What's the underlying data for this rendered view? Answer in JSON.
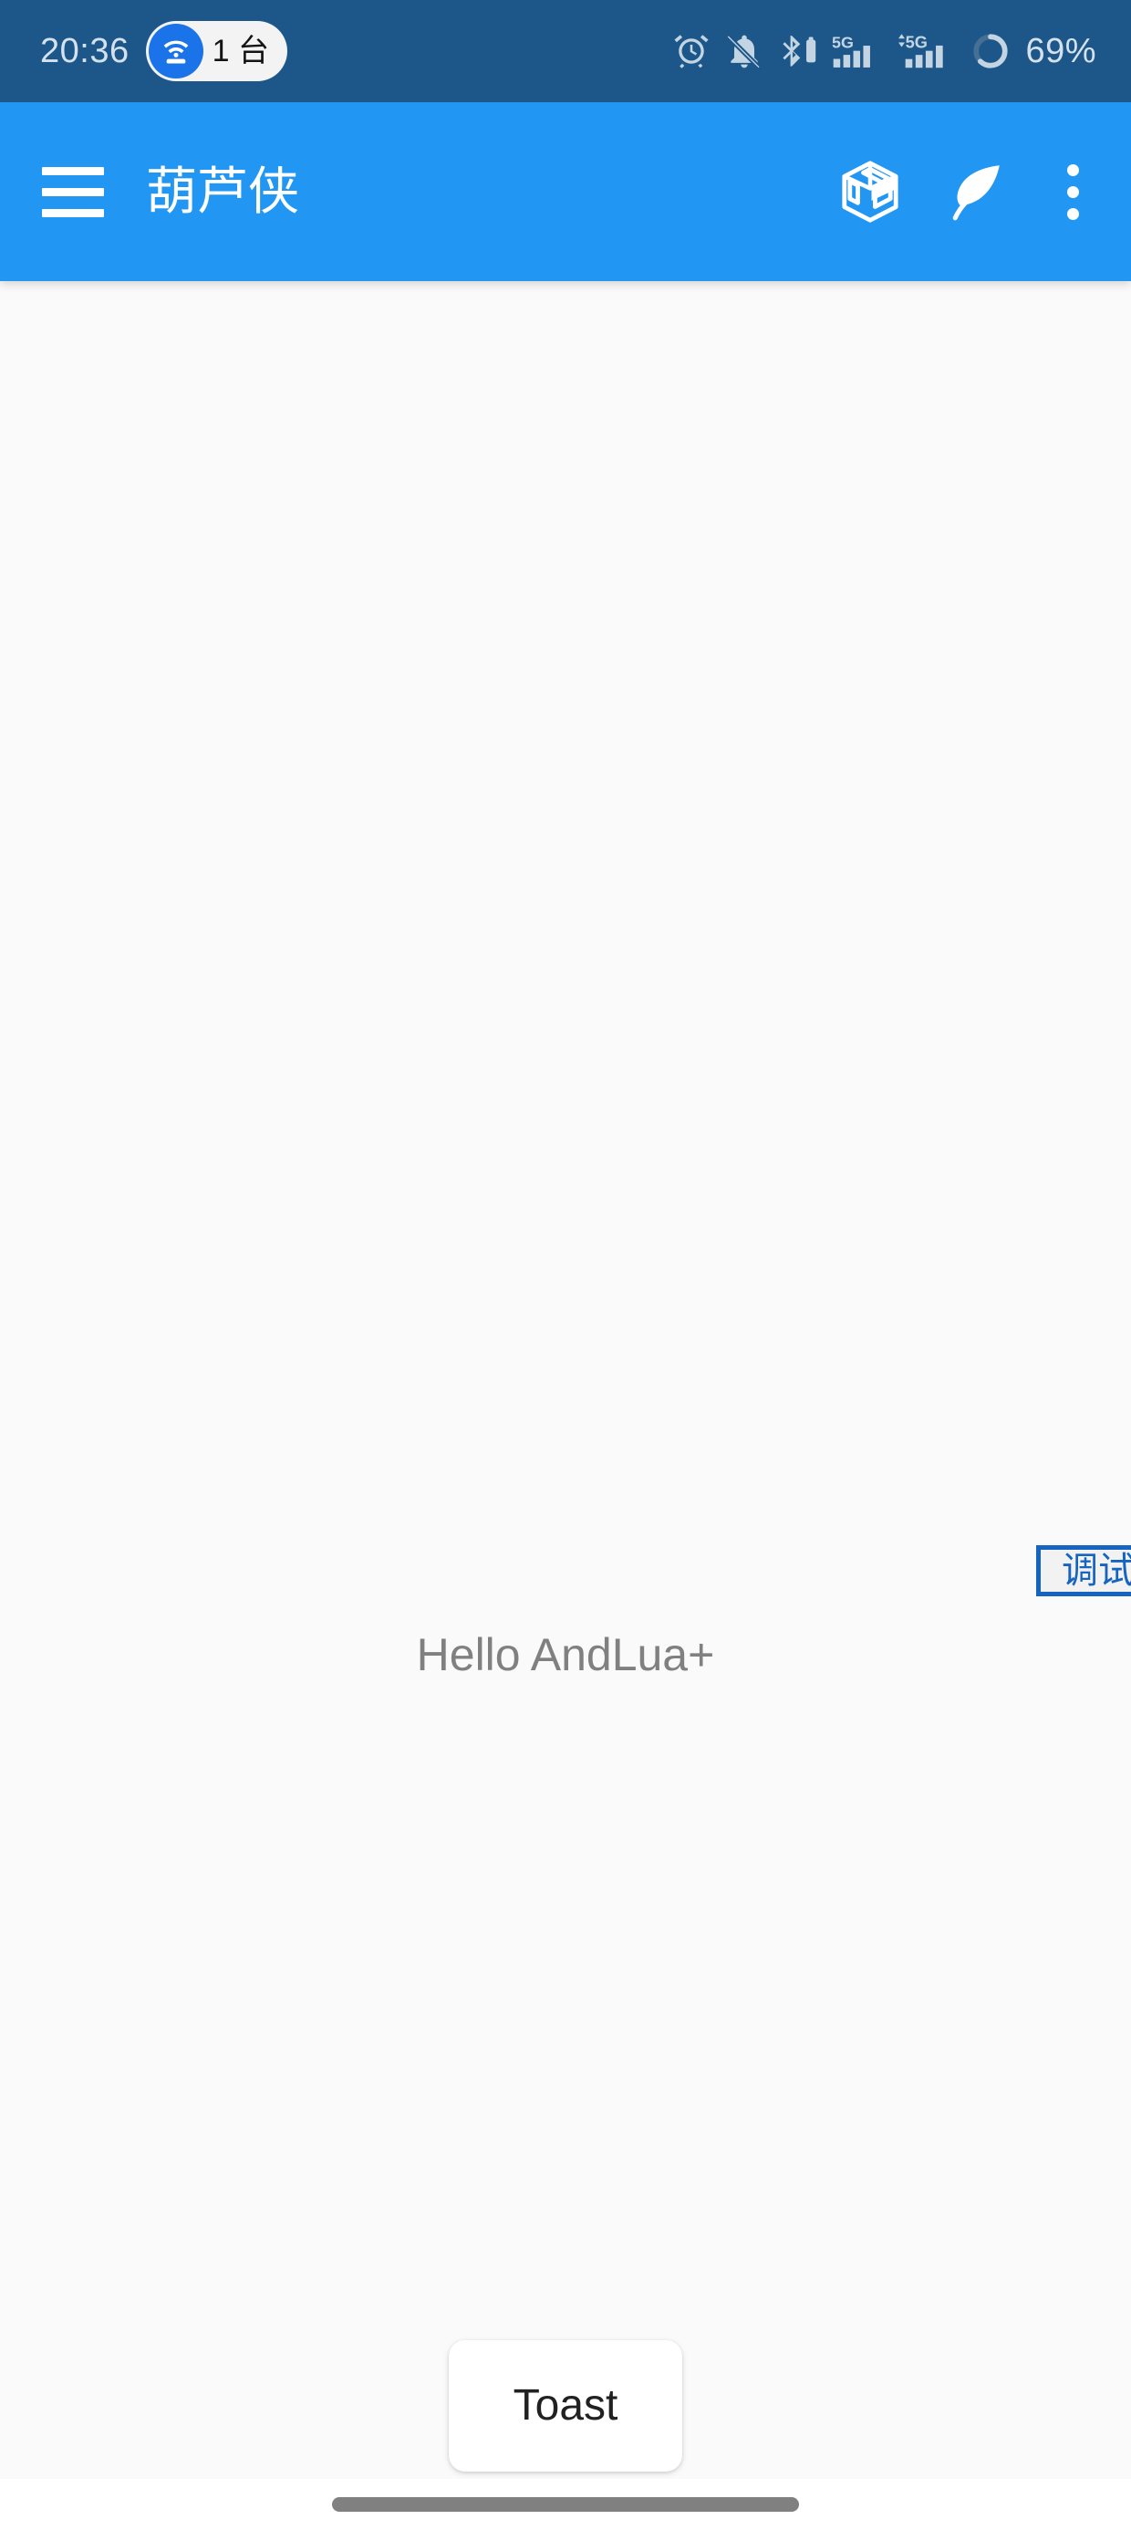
{
  "colors": {
    "status_bar_bg": "#1d5789",
    "app_bar_bg": "#2196f3",
    "content_bg": "#fafafa",
    "accent_blue": "#1a73e8",
    "debug_border": "#1565c0",
    "hello_text": "#808080",
    "nav_pill": "#808080"
  },
  "status_bar": {
    "clock": "20:36",
    "hotspot_chip": {
      "icon": "wifi-hotspot-icon",
      "label": "1 台"
    },
    "icons": [
      "alarm-clock-icon",
      "notifications-muted-icon",
      "bluetooth-battery-icon",
      "signal-5g-icon",
      "signal-5g-data-icon",
      "battery-ring-icon"
    ],
    "battery_percent": "69%"
  },
  "app_bar": {
    "menu_icon": "hamburger-menu-icon",
    "title": "葫芦侠",
    "actions": [
      {
        "name": "package-box-icon"
      },
      {
        "name": "leaf-icon"
      },
      {
        "name": "overflow-menu-icon"
      }
    ]
  },
  "content": {
    "hello_label": "Hello AndLua+",
    "debug_button_label": "调试",
    "toast_button_label": "Toast"
  },
  "nav_bar": {
    "gesture_pill": "home-gesture-pill"
  }
}
